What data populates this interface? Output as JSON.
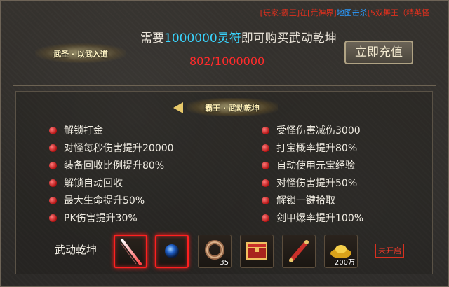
{
  "ticker": {
    "part1": "[玩家-霸王]在[荒神界]",
    "part2": "地图击杀",
    "part3": "[5双舞王（精英怪"
  },
  "header": {
    "prefix": "需要",
    "amount": "1000000灵符",
    "suffix": "即可购买武动乾坤",
    "progress": "802/1000000",
    "progress_current": 802,
    "progress_total": 1000000
  },
  "left_badge": "武圣 · 以武入道",
  "recharge_label": "立即充值",
  "title_badge": "霸王 · 武动乾坤",
  "perks_left": [
    "解锁打金",
    "对怪每秒伤害提升20000",
    "装备回收比例提升80%",
    "解锁自动回收",
    "最大生命提升50%",
    "PK伤害提升30%"
  ],
  "perks_right": [
    "受怪伤害减伤3000",
    "打宝概率提升80%",
    "自动使用元宝经验",
    "对怪伤害提升50%",
    "解锁一键拾取",
    "剑甲爆率提升100%"
  ],
  "rewards": {
    "label": "武动乾坤",
    "items": [
      {
        "icon": "light-sword-icon",
        "count": ""
      },
      {
        "icon": "blue-orb-icon",
        "count": ""
      },
      {
        "icon": "ring-icon",
        "count": "35"
      },
      {
        "icon": "treasure-chest-icon",
        "count": ""
      },
      {
        "icon": "scroll-icon",
        "count": ""
      },
      {
        "icon": "gold-ingot-icon",
        "count": "200万"
      }
    ],
    "status": "未开启"
  },
  "colors": {
    "accent_blue": "#39d5ff",
    "progress_red": "#ff2b2b",
    "dot_red": "#b11010"
  }
}
